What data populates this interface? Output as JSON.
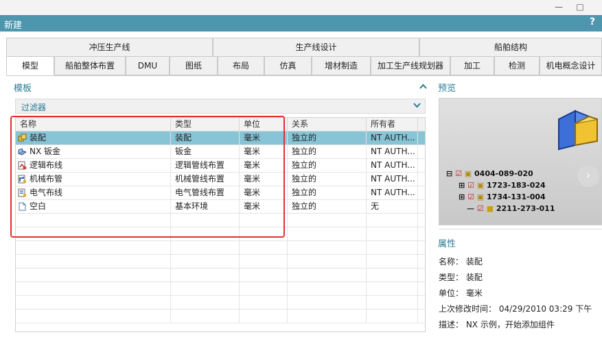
{
  "window": {
    "title": "新建",
    "help_glyph": "?",
    "minimize_glyph": "—",
    "maximize_glyph": "□"
  },
  "tabs_row1": [
    {
      "label": "冲压生产线"
    },
    {
      "label": "生产线设计"
    },
    {
      "label": "船舶结构"
    }
  ],
  "tabs_row2": [
    {
      "label": "模型",
      "active": true
    },
    {
      "label": "船舶整体布置"
    },
    {
      "label": "DMU"
    },
    {
      "label": "图纸"
    },
    {
      "label": "布局"
    },
    {
      "label": "仿真"
    },
    {
      "label": "增材制造"
    },
    {
      "label": "加工生产线规划器"
    },
    {
      "label": "加工"
    },
    {
      "label": "检测"
    },
    {
      "label": "机电概念设计"
    }
  ],
  "templates": {
    "title": "模板",
    "filter_label": "过滤器",
    "columns": [
      "名称",
      "类型",
      "单位",
      "关系",
      "所有者"
    ],
    "rows": [
      {
        "name": "装配",
        "type": "装配",
        "unit": "毫米",
        "relation": "独立的",
        "owner": "NT AUTH...",
        "icon": "assembly-icon",
        "selected": true
      },
      {
        "name": "NX 钣金",
        "type": "钣金",
        "unit": "毫米",
        "relation": "独立的",
        "owner": "NT AUTH...",
        "icon": "sheet-metal-icon"
      },
      {
        "name": "逻辑布线",
        "type": "逻辑管线布置",
        "unit": "毫米",
        "relation": "独立的",
        "owner": "NT AUTH...",
        "icon": "logical-routing-icon"
      },
      {
        "name": "机械布管",
        "type": "机械管线布置",
        "unit": "毫米",
        "relation": "独立的",
        "owner": "NT AUTH...",
        "icon": "mechanical-routing-icon"
      },
      {
        "name": "电气布线",
        "type": "电气管线布置",
        "unit": "毫米",
        "relation": "独立的",
        "owner": "NT AUTH...",
        "icon": "electrical-routing-icon"
      },
      {
        "name": "空白",
        "type": "基本环境",
        "unit": "毫米",
        "relation": "独立的",
        "owner": "无",
        "icon": "blank-file-icon"
      }
    ]
  },
  "preview": {
    "title": "预览",
    "tree": [
      {
        "label": "0404-089-020",
        "expander": "⊟"
      },
      {
        "label": "1723-183-024",
        "expander": "⊞"
      },
      {
        "label": "1734-131-004",
        "expander": "⊞"
      },
      {
        "label": "2211-273-011",
        "expander": ""
      }
    ],
    "next_glyph": "›"
  },
  "properties": {
    "title": "属性",
    "name_line": "名称： 装配",
    "type_line": "类型： 装配",
    "unit_line": "单位： 毫米",
    "modified_line": "上次修改时间： 04/29/2010 03:29 下午",
    "desc_line": "描述： NX 示例，开始添加组件"
  },
  "colors": {
    "title_bar": "#4d96ad",
    "accent": "#2a7b95",
    "selected_row": "#87c4d6",
    "highlight_box": "#e03030"
  }
}
